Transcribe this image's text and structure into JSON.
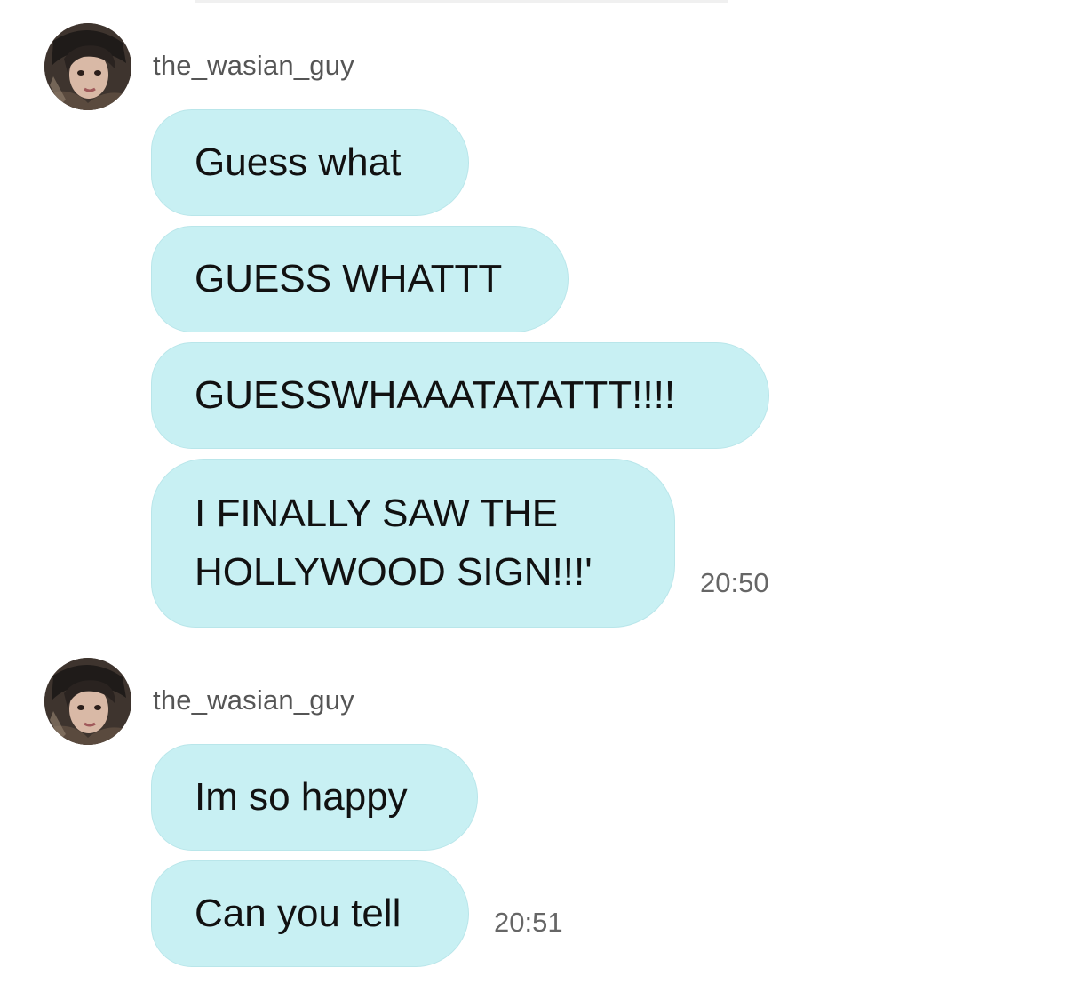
{
  "messages": [
    {
      "sender": "the_wasian_guy",
      "avatar_icon": "profile-photo",
      "bubbles": [
        {
          "text": "Guess what"
        },
        {
          "text": "GUESS WHATTT"
        },
        {
          "text": "GUESSWHAAATATATTT!!!!"
        },
        {
          "lines": [
            "I FINALLY SAW THE",
            "HOLLYWOOD SIGN!!!'"
          ]
        }
      ],
      "time": "20:50"
    },
    {
      "sender": "the_wasian_guy",
      "avatar_icon": "profile-photo",
      "bubbles": [
        {
          "text": "Im so happy"
        },
        {
          "text": "Can you tell"
        }
      ],
      "time": "20:51"
    }
  ],
  "colors": {
    "bubble": "#c8f0f3",
    "bubble_border": "#b9e6ea",
    "sender_text": "#555555",
    "timestamp_text": "#666666",
    "background": "#ffffff"
  }
}
